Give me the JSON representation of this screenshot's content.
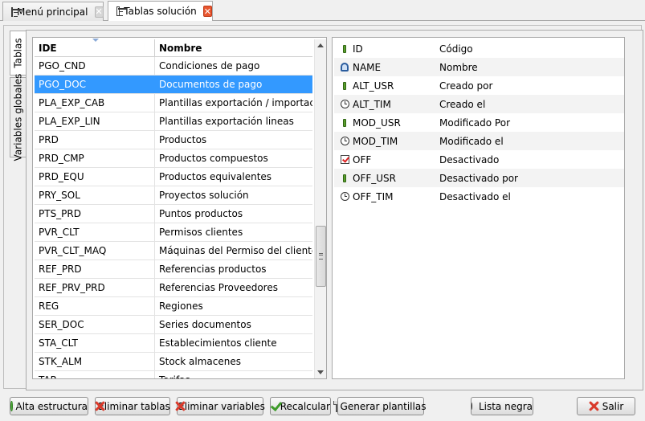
{
  "doc_tabs": [
    {
      "label": "Menú principal",
      "close_icon": "close-icon"
    },
    {
      "label": "Tablas solución",
      "close_icon": "close-icon"
    }
  ],
  "side_tabs": [
    {
      "label": "Tablas"
    },
    {
      "label": "Variables globales"
    }
  ],
  "tables_grid": {
    "columns": [
      "IDE",
      "Nombre"
    ],
    "selected_index": 1,
    "rows": [
      {
        "ide": "PGO_CND",
        "nombre": "Condiciones de pago"
      },
      {
        "ide": "PGO_DOC",
        "nombre": "Documentos de pago"
      },
      {
        "ide": "PLA_EXP_CAB",
        "nombre": "Plantillas exportación / importaci..."
      },
      {
        "ide": "PLA_EXP_LIN",
        "nombre": "Plantillas exportación lineas"
      },
      {
        "ide": "PRD",
        "nombre": "Productos"
      },
      {
        "ide": "PRD_CMP",
        "nombre": "Productos compuestos"
      },
      {
        "ide": "PRD_EQU",
        "nombre": "Productos equivalentes"
      },
      {
        "ide": "PRY_SOL",
        "nombre": "Proyectos solución"
      },
      {
        "ide": "PTS_PRD",
        "nombre": "Puntos productos"
      },
      {
        "ide": "PVR_CLT",
        "nombre": "Permisos clientes"
      },
      {
        "ide": "PVR_CLT_MAQ",
        "nombre": "Máquinas del Permiso del cliente"
      },
      {
        "ide": "REF_PRD",
        "nombre": "Referencias productos"
      },
      {
        "ide": "REF_PRV_PRD",
        "nombre": "Referencias Proveedores"
      },
      {
        "ide": "REG",
        "nombre": "Regiones"
      },
      {
        "ide": "SER_DOC",
        "nombre": "Series documentos"
      },
      {
        "ide": "STA_CLT",
        "nombre": "Establecimientos cliente"
      },
      {
        "ide": "STK_ALM",
        "nombre": "Stock almacenes"
      },
      {
        "ide": "TAR",
        "nombre": "Tarifas"
      }
    ]
  },
  "fields": [
    {
      "icon": "key-icon",
      "name": "ID",
      "desc": "Código"
    },
    {
      "icon": "name-icon",
      "name": "NAME",
      "desc": "Nombre"
    },
    {
      "icon": "key-icon",
      "name": "ALT_USR",
      "desc": "Creado por"
    },
    {
      "icon": "clock-icon",
      "name": "ALT_TIM",
      "desc": "Creado el"
    },
    {
      "icon": "key-icon",
      "name": "MOD_USR",
      "desc": "Modificado Por"
    },
    {
      "icon": "clock-icon",
      "name": "MOD_TIM",
      "desc": "Modificado el"
    },
    {
      "icon": "checkbox-icon",
      "name": "OFF",
      "desc": "Desactivado"
    },
    {
      "icon": "key-icon",
      "name": "OFF_USR",
      "desc": "Desactivado por"
    },
    {
      "icon": "clock-icon",
      "name": "OFF_TIM",
      "desc": "Desactivado el"
    }
  ],
  "buttons": {
    "alta_estructura": "Alta estructura",
    "eliminar_tablas": "Eliminar tablas",
    "eliminar_variables": "Eliminar variables",
    "recalcular": "Recalcular",
    "generar_plantillas": "Generar plantillas",
    "lista_negra": "Lista negra",
    "salir": "Salir"
  }
}
